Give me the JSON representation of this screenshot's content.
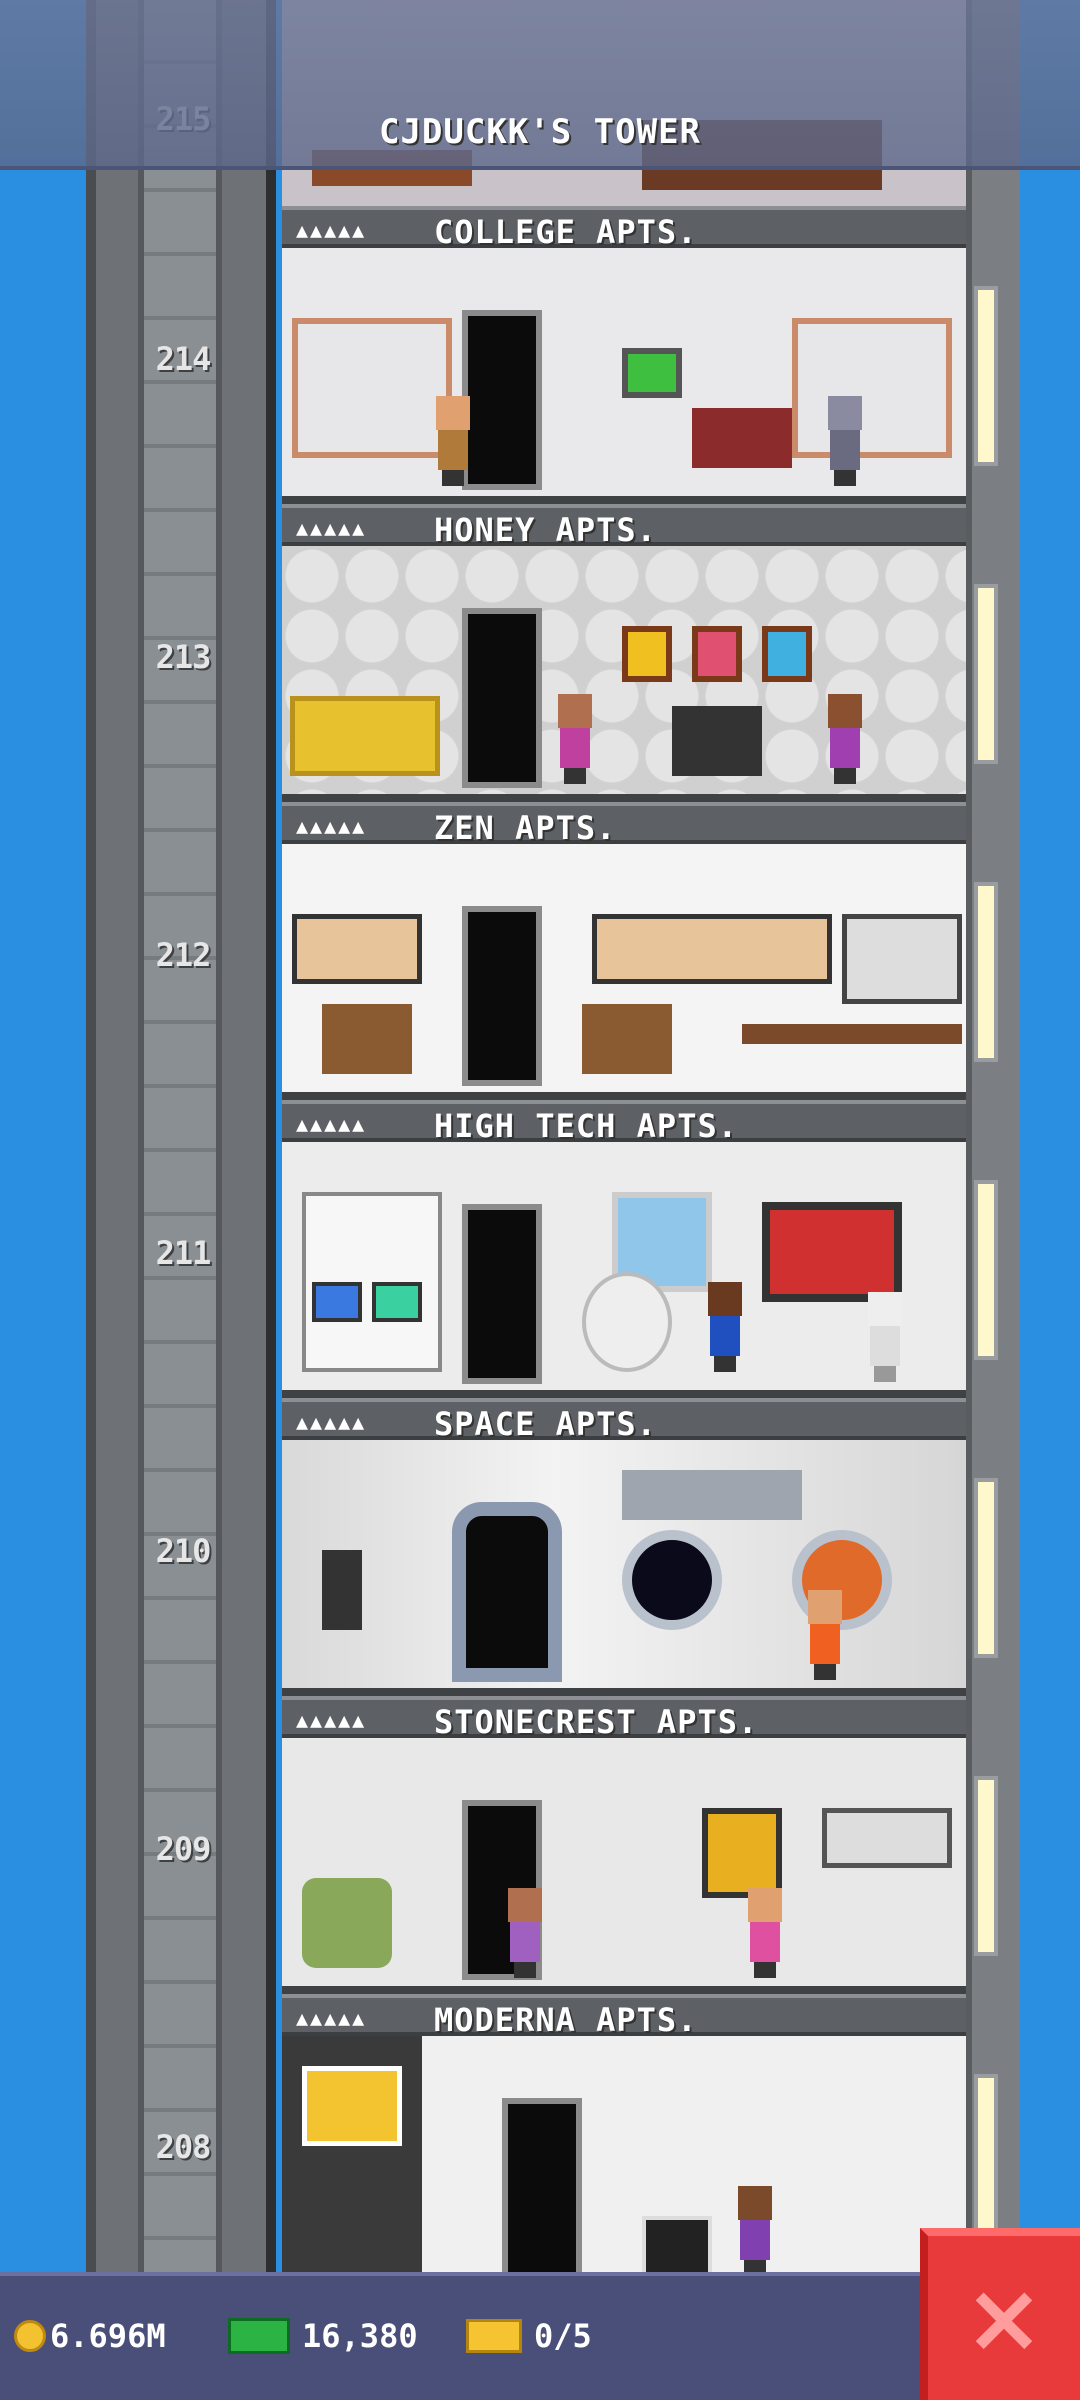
{
  "header": {
    "title": "CJDUCKK'S TOWER",
    "top_floor_number": "215"
  },
  "floors": [
    {
      "number": "214",
      "name": "COLLEGE APTS.",
      "occupants": "▲▲▲▲▲",
      "theme": "t-college"
    },
    {
      "number": "213",
      "name": "HONEY APTS.",
      "occupants": "▲▲▲▲▲",
      "theme": "t-honey"
    },
    {
      "number": "212",
      "name": "ZEN APTS.",
      "occupants": "▲▲▲▲▲",
      "theme": "t-zen"
    },
    {
      "number": "211",
      "name": "HIGH TECH APTS.",
      "occupants": "▲▲▲▲▲",
      "theme": "t-high"
    },
    {
      "number": "210",
      "name": "SPACE APTS.",
      "occupants": "▲▲▲▲▲",
      "theme": "t-space"
    },
    {
      "number": "209",
      "name": "STONECREST APTS.",
      "occupants": "▲▲▲▲▲",
      "theme": "t-stone"
    },
    {
      "number": "208",
      "name": "MODERNA APTS.",
      "occupants": "▲▲▲▲▲",
      "theme": "t-moderna"
    }
  ],
  "stats": {
    "coins": "6.696M",
    "bux": "16,380",
    "tickets": "0/5"
  },
  "close_icon": "×",
  "colors": {
    "sky": "#2a8fe0",
    "header": "#5d688a",
    "bottom_bar": "#4a4f79",
    "close": "#e83a3a"
  }
}
